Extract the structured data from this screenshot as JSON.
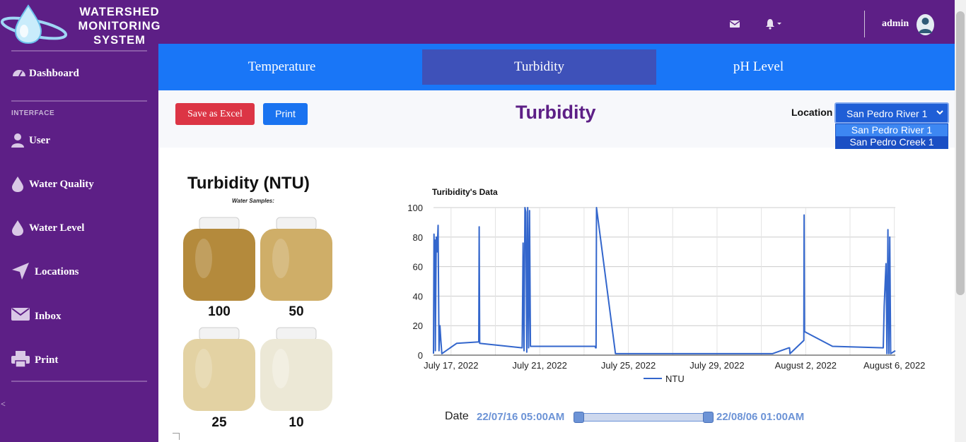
{
  "brand": {
    "line1": "WATERSHED",
    "line2": "MONITORING",
    "line3": "SYSTEM"
  },
  "topbar": {
    "user": "admin",
    "icons": [
      "envelope-icon",
      "bell-icon",
      "user-avatar-icon"
    ]
  },
  "sidebar": {
    "heading": "INTERFACE",
    "toggle": "<",
    "items": [
      {
        "label": "Dashboard",
        "icon": "gauge-icon"
      },
      {
        "label": "User",
        "icon": "user-icon"
      },
      {
        "label": "Water Quality",
        "icon": "droplet-icon"
      },
      {
        "label": "Water Level",
        "icon": "droplet-icon"
      },
      {
        "label": "Locations",
        "icon": "location-arrow-icon"
      },
      {
        "label": "Inbox",
        "icon": "envelope-icon"
      },
      {
        "label": "Print",
        "icon": "printer-icon"
      }
    ]
  },
  "tabs": [
    {
      "label": "Temperature",
      "active": false
    },
    {
      "label": "Turbidity",
      "active": true
    },
    {
      "label": "pH Level",
      "active": false
    }
  ],
  "toolbar": {
    "excel_label": "Save as Excel",
    "print_label": "Print",
    "page_title": "Turbidity",
    "location_label": "Location",
    "location_value": "San Pedro River 1",
    "location_options": [
      "San Pedro River 1",
      "San Pedro Creek 1"
    ]
  },
  "infographic": {
    "title": "Turbidity (NTU)",
    "subtitle": "Water Samples:",
    "samples": [
      {
        "value": "100",
        "color": "#b48a3c"
      },
      {
        "value": "50",
        "color": "#cfae68"
      },
      {
        "value": "25",
        "color": "#e3d2a3"
      },
      {
        "value": "10",
        "color": "#ece8d6"
      }
    ]
  },
  "chart_data": {
    "type": "line",
    "title": "Turibidity's Data",
    "xlabel": "",
    "ylabel": "",
    "ylim": [
      0,
      100
    ],
    "yticks": [
      "0",
      "20",
      "40",
      "60",
      "80",
      "100"
    ],
    "xticks": [
      "July 17, 2022",
      "July 21, 2022",
      "July 25, 2022",
      "July 29, 2022",
      "August 2, 2022",
      "August 6, 2022"
    ],
    "xlim": [
      "2022-07-16T05:00",
      "2022-08-06T01:00"
    ],
    "series": [
      {
        "name": "NTU",
        "color": "#3366cc",
        "x": [
          "2022-07-16T05:00",
          "2022-07-16T05:30",
          "2022-07-16T06:00",
          "2022-07-16T06:30",
          "2022-07-16T07:00",
          "2022-07-16T08:00",
          "2022-07-16T09:00",
          "2022-07-16T10:00",
          "2022-07-16T11:00",
          "2022-07-16T12:00",
          "2022-07-16T13:00",
          "2022-07-16T14:00",
          "2022-07-17T06:00",
          "2022-07-18T06:00",
          "2022-07-18T06:30",
          "2022-07-18T07:00",
          "2022-07-20T05:00",
          "2022-07-20T06:00",
          "2022-07-20T07:00",
          "2022-07-20T08:00",
          "2022-07-20T09:00",
          "2022-07-20T10:00",
          "2022-07-20T11:00",
          "2022-07-20T12:00",
          "2022-07-20T13:00",
          "2022-07-20T14:00",
          "2022-07-23T12:00",
          "2022-07-23T12:30",
          "2022-07-23T12:40",
          "2022-07-23T13:00",
          "2022-07-23T13:30",
          "2022-07-24T10:00",
          "2022-07-24T10:30",
          "2022-07-24T11:00",
          "2022-07-25T02:00",
          "2022-07-31T12:00",
          "2022-08-01T06:00",
          "2022-08-01T06:30",
          "2022-08-01T07:00",
          "2022-08-01T22:00",
          "2022-08-01T22:20",
          "2022-08-01T22:40",
          "2022-08-03T05:00",
          "2022-08-05T12:00",
          "2022-08-05T13:00",
          "2022-08-05T14:00",
          "2022-08-05T15:00",
          "2022-08-05T16:00",
          "2022-08-05T17:00",
          "2022-08-05T18:00",
          "2022-08-05T19:00",
          "2022-08-05T20:00",
          "2022-08-06T01:00"
        ],
        "values": [
          1,
          82,
          65,
          78,
          3,
          80,
          70,
          88,
          3,
          20,
          10,
          1,
          8,
          9,
          87,
          8,
          5,
          76,
          3,
          100,
          97,
          2,
          100,
          5,
          98,
          6,
          6,
          5,
          6,
          5,
          100,
          1,
          1,
          1,
          1,
          1,
          5,
          5,
          1,
          10,
          95,
          16,
          6,
          5,
          33,
          48,
          62,
          1,
          85,
          1,
          80,
          1,
          3
        ]
      }
    ],
    "legend": "bottom",
    "grid": true
  },
  "range": {
    "label": "Date",
    "start": "22/07/16 05:00AM",
    "end": "22/08/06 01:00AM"
  }
}
